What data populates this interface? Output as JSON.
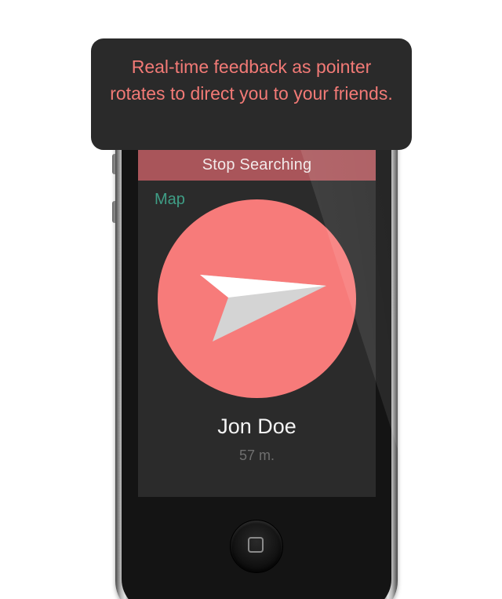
{
  "tooltip": {
    "text": "Real-time feedback as pointer rotates to direct you to your friends."
  },
  "screen": {
    "stop_button_label": "Stop Searching",
    "map_link_label": "Map",
    "pointer_icon": "arrow-pointer-icon",
    "friend": {
      "name": "Jon Doe",
      "distance": "57 m."
    }
  },
  "device": {
    "home_button_icon": "home-square-icon"
  },
  "colors": {
    "accent": "#f77b7a",
    "tooltip_text": "#f27a76",
    "stop_bar": "#a9555a",
    "map_link": "#3f9e86",
    "screen_bg": "#2b2b2b",
    "pointer": "#d9d9d9"
  }
}
